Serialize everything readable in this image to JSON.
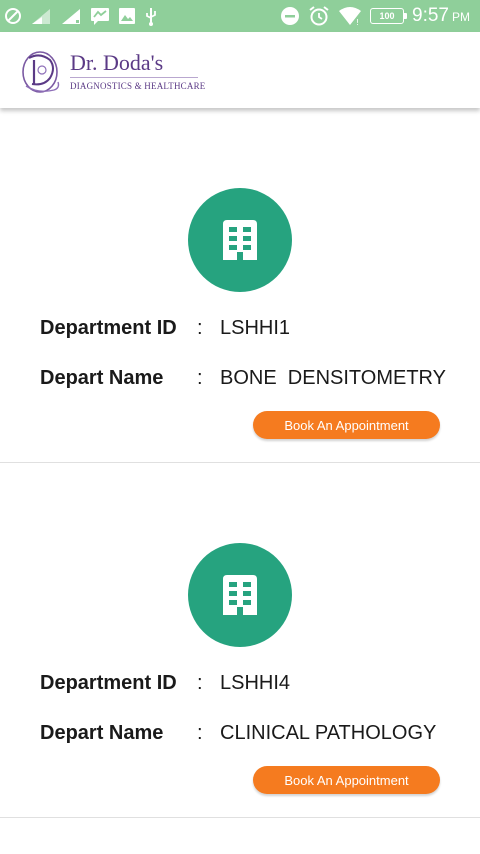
{
  "status_bar": {
    "time": "9:57",
    "ampm": "PM",
    "battery": "100",
    "icons_left": [
      "blocked-icon",
      "signal-icon",
      "signal-icon",
      "chat-icon",
      "image-icon",
      "usb-icon"
    ],
    "icons_right": [
      "minus-circle-icon",
      "alarm-icon",
      "wifi-icon",
      "battery-icon"
    ]
  },
  "header": {
    "brand_name": "Dr. Doda's",
    "brand_sub": "DIAGNOSTICS & HEALTHCARE"
  },
  "departments": [
    {
      "id_label": "Department ID",
      "id_value": "LSHHI1",
      "name_label": "Depart Name",
      "name_value": "BONE  DENSITOMETRY",
      "colon": ":",
      "button": "Book An Appointment"
    },
    {
      "id_label": "Department ID",
      "id_value": "LSHHI4",
      "name_label": "Depart Name",
      "name_value": "CLINICAL PATHOLOGY",
      "colon": ":",
      "button": "Book An Appointment"
    }
  ],
  "colors": {
    "status_bar": "#8fcf9a",
    "icon_circle": "#26a37f",
    "button": "#f57b1f",
    "brand": "#5b3a86"
  }
}
